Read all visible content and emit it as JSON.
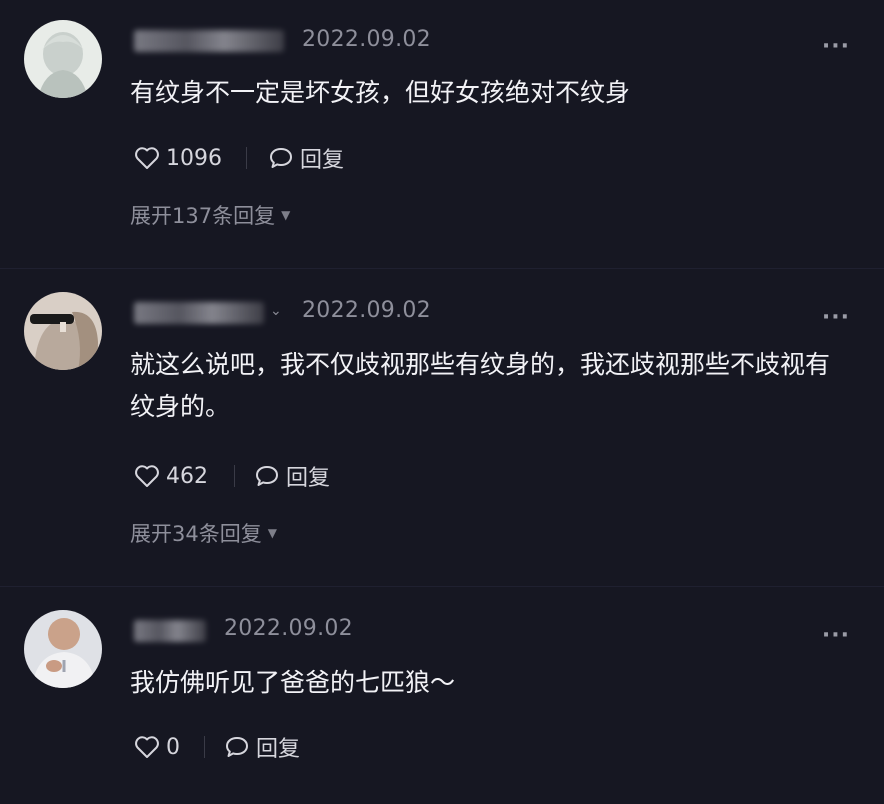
{
  "comments": [
    {
      "date": "2022.09.02",
      "more": "···",
      "text": "有纹身不一定是坏女孩，但好女孩绝对不纹身",
      "likes": "1096",
      "reply_label": "回复",
      "expand_label": "展开137条回复"
    },
    {
      "date": "2022.09.02",
      "more": "···",
      "text": "就这么说吧，我不仅歧视那些有纹身的，我还歧视那些不歧视有纹身的。",
      "likes": "462",
      "reply_label": "回复",
      "expand_label": "展开34条回复"
    },
    {
      "date": "2022.09.02",
      "more": "···",
      "text": "我仿佛听见了爸爸的七匹狼～",
      "likes": "0",
      "reply_label": "回复"
    }
  ],
  "icons": {
    "like": "heart-outline-icon",
    "reply": "speech-bubble-icon",
    "more": "ellipsis-icon",
    "expand": "caret-down-icon"
  }
}
